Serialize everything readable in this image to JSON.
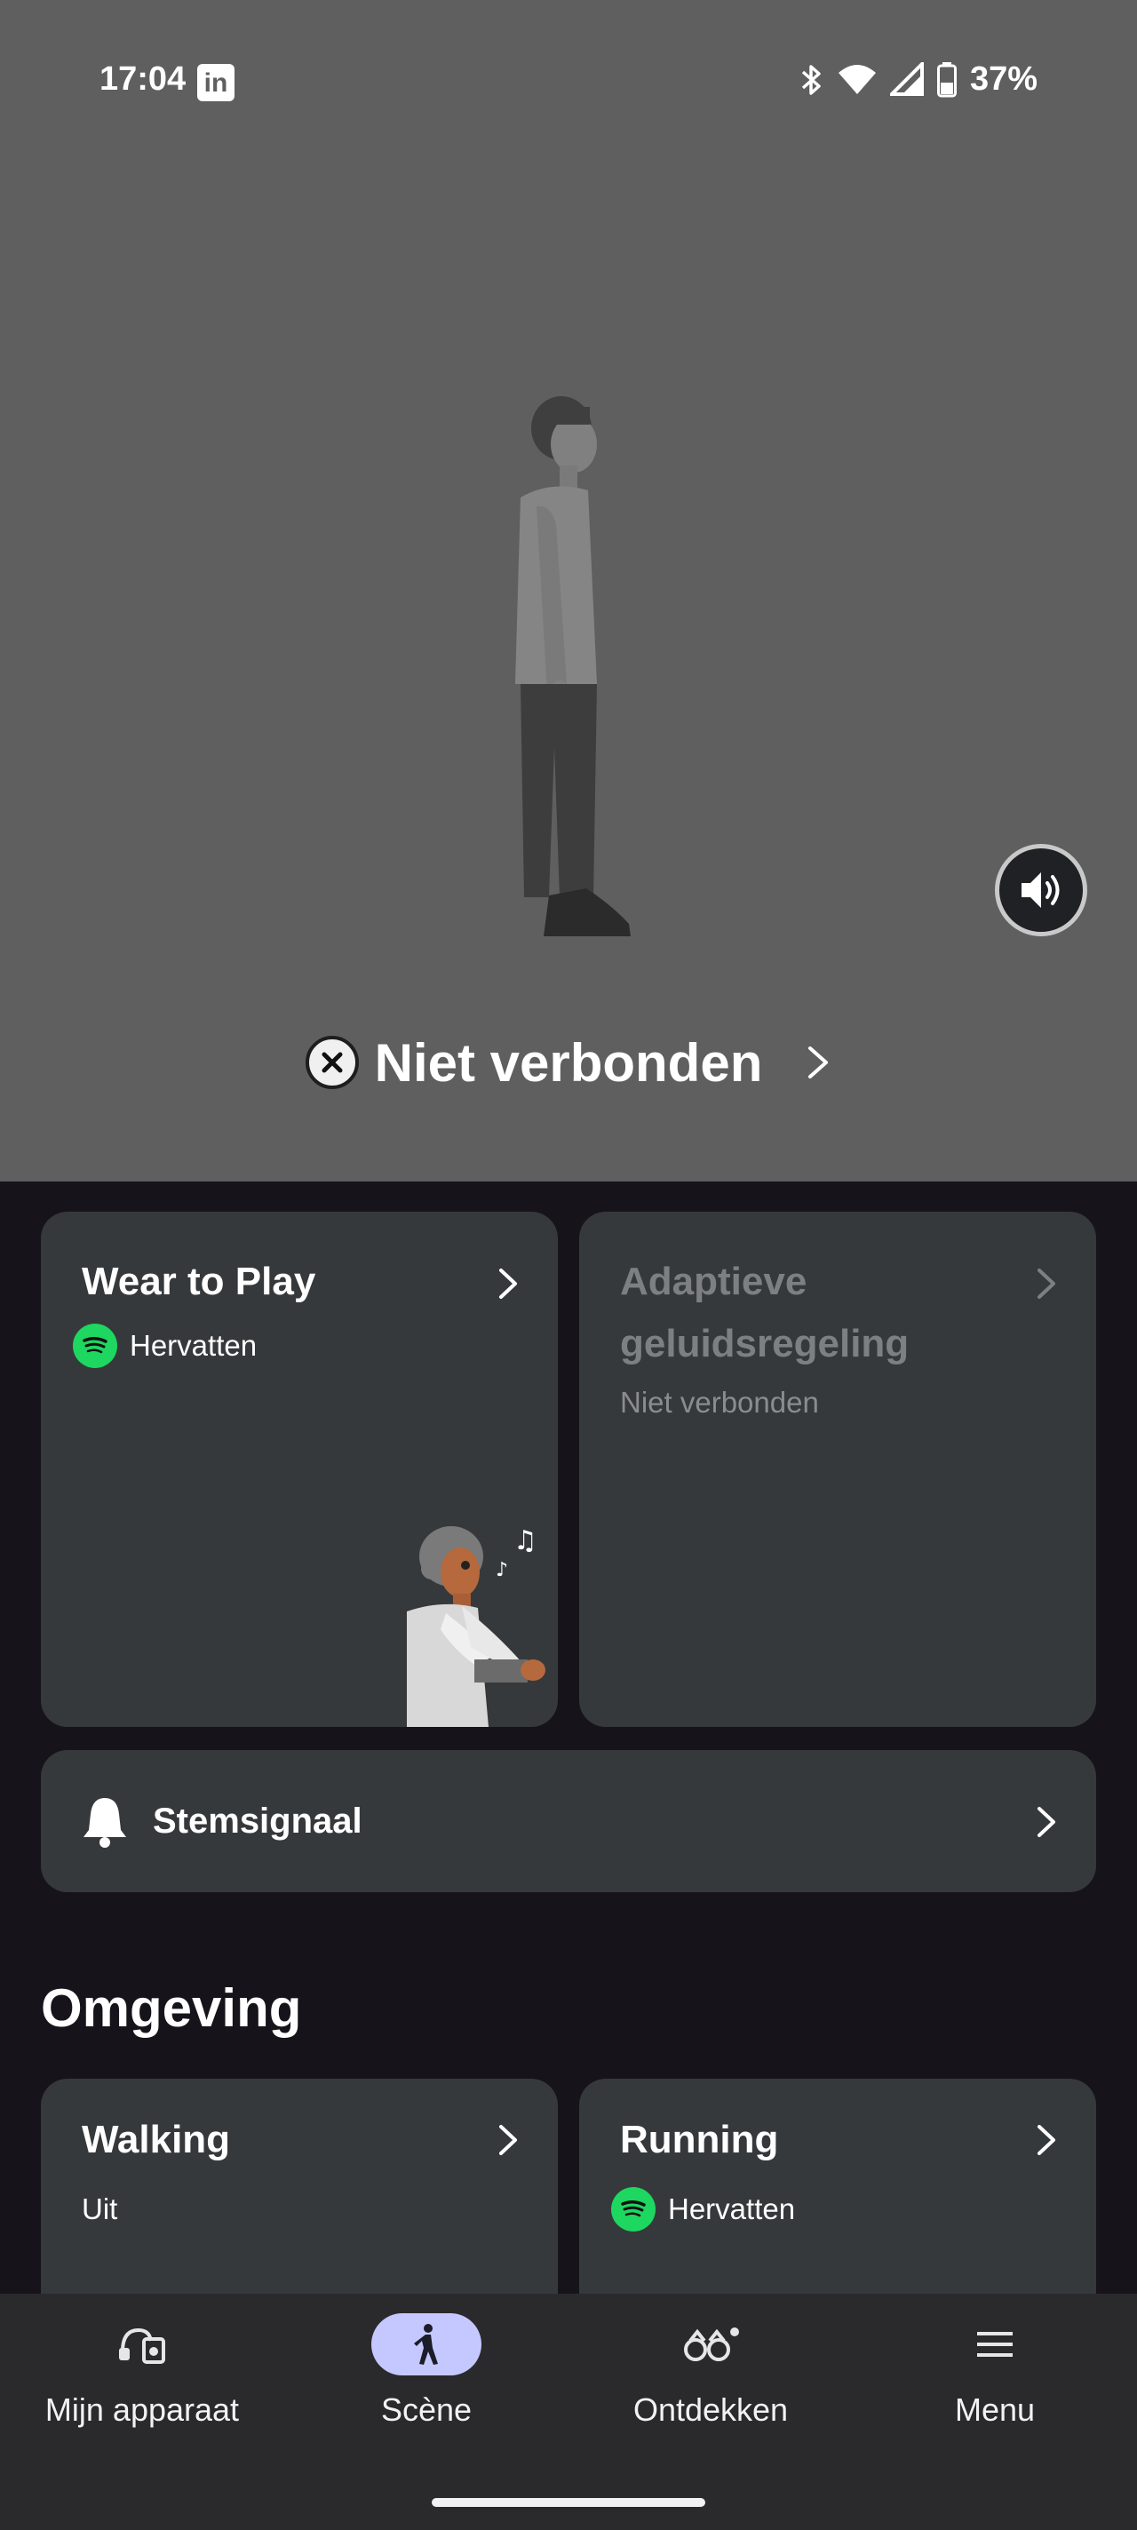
{
  "status_bar": {
    "time": "17:04",
    "battery": "37%",
    "icons": [
      "linkedin-icon",
      "bluetooth-icon",
      "wifi-icon",
      "signal-icon",
      "battery-icon"
    ]
  },
  "hero": {
    "connection_status": "Niet verbonden"
  },
  "cards": {
    "wear_to_play": {
      "title": "Wear to Play",
      "spotify_label": "Hervatten"
    },
    "adaptive_sound": {
      "title_line1": "Adaptieve",
      "title_line2": "geluidsregeling",
      "subtitle": "Niet verbonden"
    },
    "voice_signal": {
      "label": "Stemsignaal"
    }
  },
  "section": {
    "title": "Omgeving"
  },
  "environment": {
    "walking": {
      "title": "Walking",
      "subtitle": "Uit"
    },
    "running": {
      "title": "Running",
      "spotify_label": "Hervatten"
    }
  },
  "nav": {
    "items": [
      {
        "label": "Mijn apparaat",
        "icon": "headphones-device-icon"
      },
      {
        "label": "Scène",
        "icon": "walking-person-icon",
        "active": true
      },
      {
        "label": "Ontdekken",
        "icon": "binoculars-icon"
      },
      {
        "label": "Menu",
        "icon": "hamburger-menu-icon"
      }
    ]
  },
  "colors": {
    "hero_bg": "#5f5f5f",
    "card_bg": "#36393b",
    "page_bg": "#16141a",
    "spotify": "#1ed760",
    "nav_active": "#c5c8ff"
  }
}
